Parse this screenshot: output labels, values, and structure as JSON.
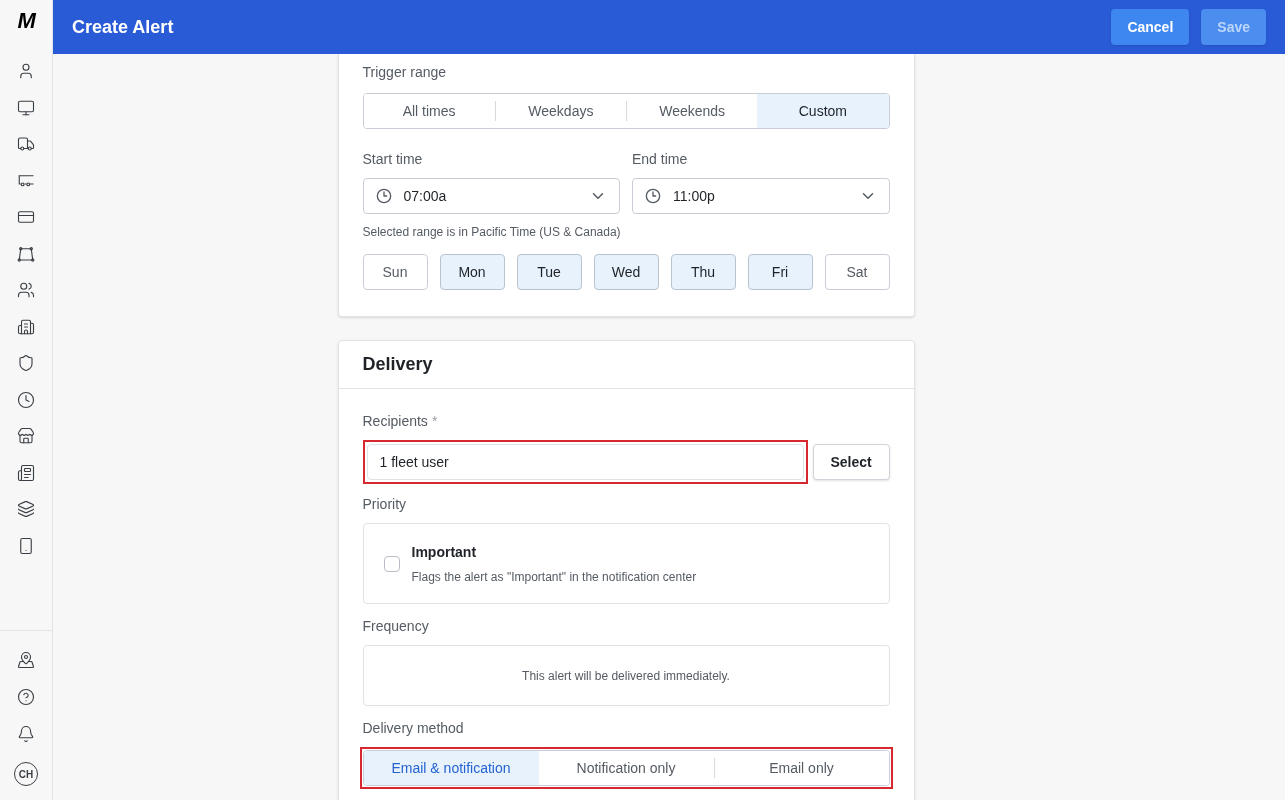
{
  "sidebar": {
    "logo": "M",
    "avatar": "CH"
  },
  "header": {
    "title": "Create Alert",
    "buttons": [
      {
        "label": "Cancel",
        "disabled": false
      },
      {
        "label": "Save",
        "disabled": true
      }
    ]
  },
  "schedule": {
    "trigger_range": {
      "label": "Trigger range",
      "options": [
        {
          "label": "All times",
          "selected": false
        },
        {
          "label": "Weekdays",
          "selected": false
        },
        {
          "label": "Weekends",
          "selected": false
        },
        {
          "label": "Custom",
          "selected": true
        }
      ]
    },
    "start_time": {
      "label": "Start time",
      "value": "07:00a"
    },
    "end_time": {
      "label": "End time",
      "value": "11:00p"
    },
    "timezone_note": "Selected range is in Pacific Time (US & Canada)",
    "days": [
      {
        "label": "Sun",
        "selected": false
      },
      {
        "label": "Mon",
        "selected": true
      },
      {
        "label": "Tue",
        "selected": true
      },
      {
        "label": "Wed",
        "selected": true
      },
      {
        "label": "Thu",
        "selected": true
      },
      {
        "label": "Fri",
        "selected": true
      },
      {
        "label": "Sat",
        "selected": false
      }
    ]
  },
  "delivery": {
    "title": "Delivery",
    "recipients": {
      "label": "Recipients",
      "required_mark": "*",
      "value": "1 fleet user",
      "highlighted": true,
      "button": "Select"
    },
    "priority": {
      "label": "Priority",
      "title": "Important",
      "description": "Flags the alert as \"Important\" in the notification center",
      "checked": false
    },
    "frequency": {
      "label": "Frequency",
      "text": "This alert will be delivered immediately."
    },
    "delivery_method": {
      "label": "Delivery method",
      "highlighted": true,
      "options": [
        {
          "label": "Email & notification",
          "selected": true
        },
        {
          "label": "Notification only",
          "selected": false
        },
        {
          "label": "Email only",
          "selected": false
        }
      ]
    }
  }
}
